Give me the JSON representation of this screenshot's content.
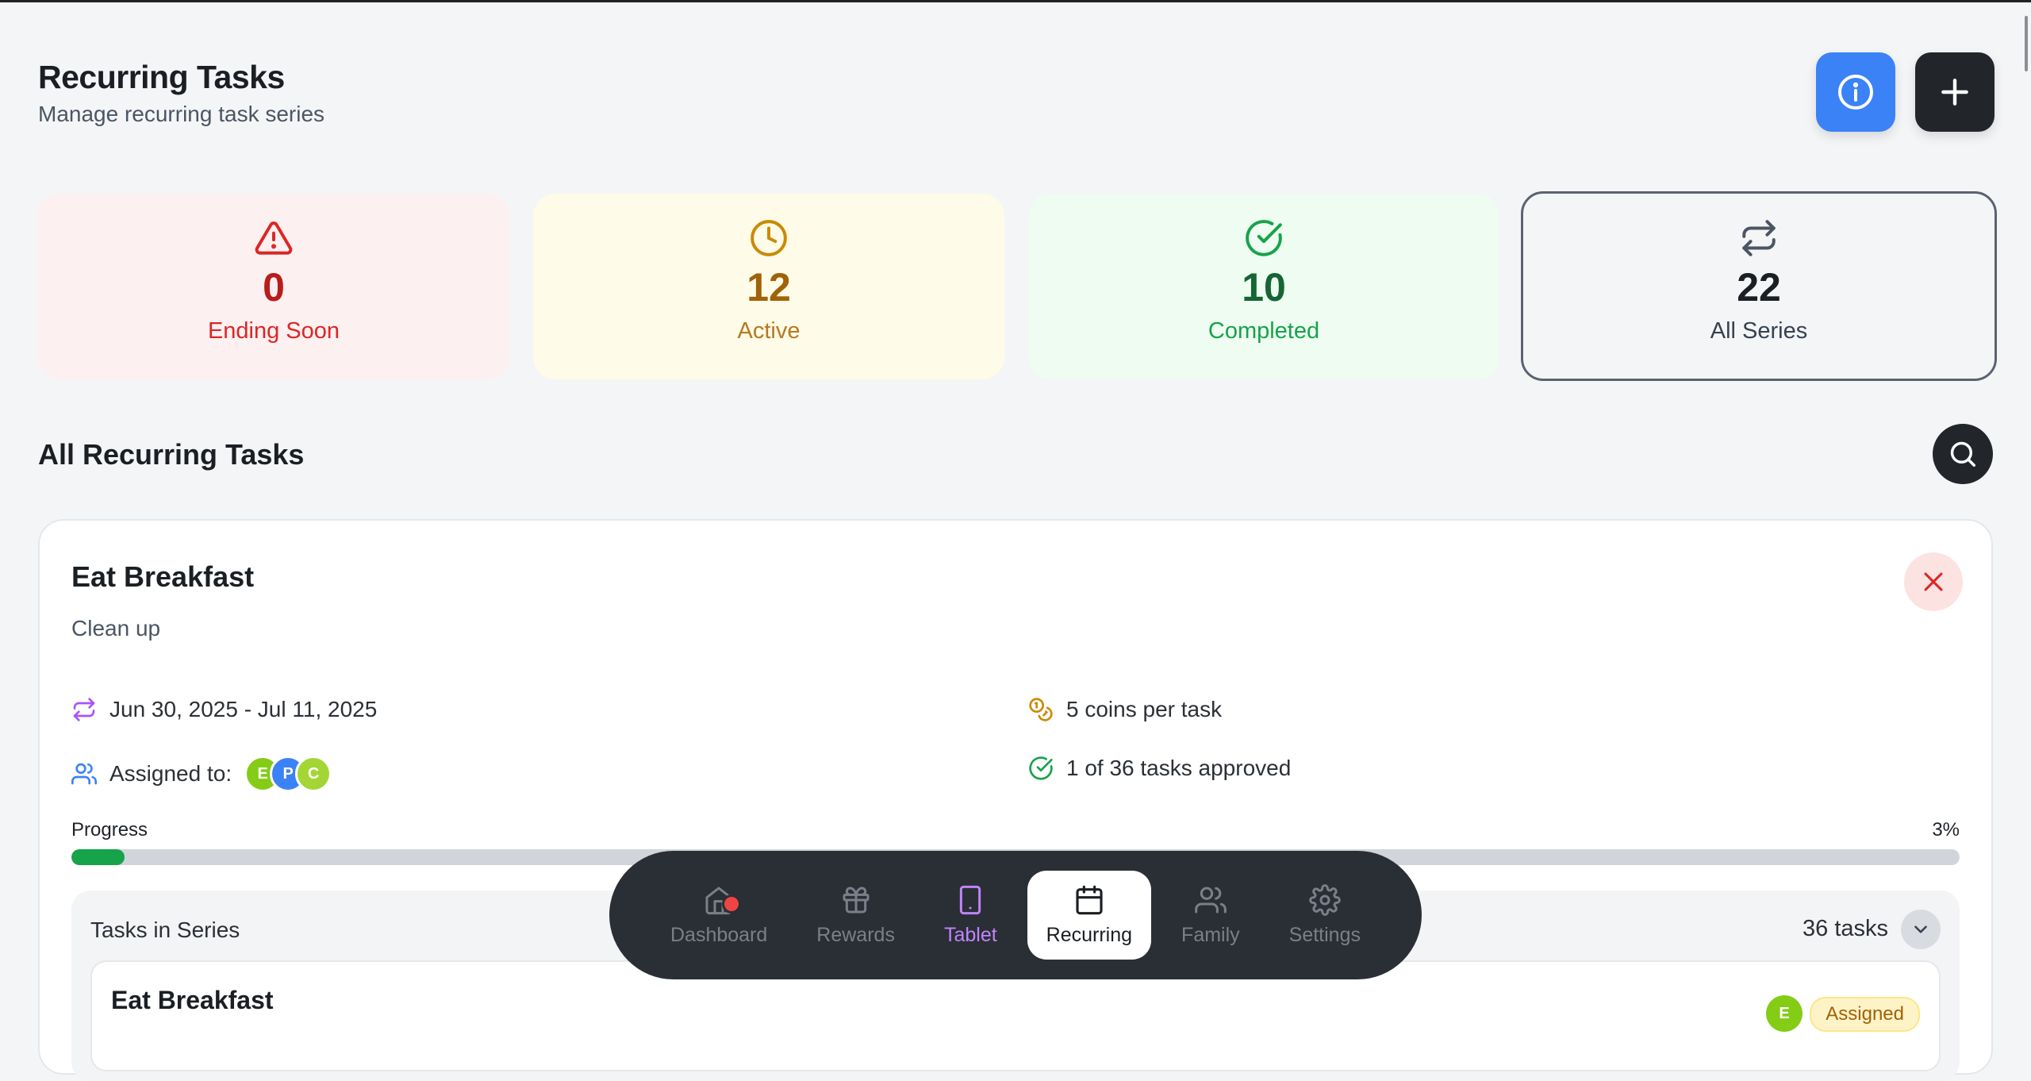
{
  "header": {
    "title": "Recurring Tasks",
    "subtitle": "Manage recurring task series"
  },
  "stats": [
    {
      "value": "0",
      "label": "Ending Soon",
      "icon": "alert-triangle-icon",
      "color": "#dc2626"
    },
    {
      "value": "12",
      "label": "Active",
      "icon": "clock-icon",
      "color": "#ca8a04"
    },
    {
      "value": "10",
      "label": "Completed",
      "icon": "check-circle-icon",
      "color": "#16a34a"
    },
    {
      "value": "22",
      "label": "All Series",
      "icon": "repeat-icon",
      "color": "#374151"
    }
  ],
  "section": {
    "title": "All Recurring Tasks"
  },
  "task": {
    "title": "Eat Breakfast",
    "description": "Clean up",
    "date_range": "Jun 30, 2025 - Jul 11, 2025",
    "assigned_label": "Assigned to:",
    "assignees": [
      {
        "initial": "E",
        "color": "#84cc16"
      },
      {
        "initial": "P",
        "color": "#3b82f6"
      },
      {
        "initial": "C",
        "color": "#a3d635"
      }
    ],
    "coins": "5 coins per task",
    "approved": "1 of 36 tasks approved",
    "progress_label": "Progress",
    "progress_pct_text": "3%",
    "progress_fraction": 0.028,
    "series": {
      "title": "Tasks in Series",
      "count": "36 tasks",
      "items": [
        {
          "title": "Eat Breakfast",
          "avatar": "E",
          "status": "Assigned"
        }
      ]
    }
  },
  "nav": {
    "items": [
      {
        "label": "Dashboard",
        "icon": "home-icon"
      },
      {
        "label": "Rewards",
        "icon": "gift-icon"
      },
      {
        "label": "Tablet",
        "icon": "tablet-icon"
      },
      {
        "label": "Recurring",
        "icon": "calendar-icon"
      },
      {
        "label": "Family",
        "icon": "users-icon"
      },
      {
        "label": "Settings",
        "icon": "gear-icon"
      }
    ],
    "active": "Recurring"
  }
}
